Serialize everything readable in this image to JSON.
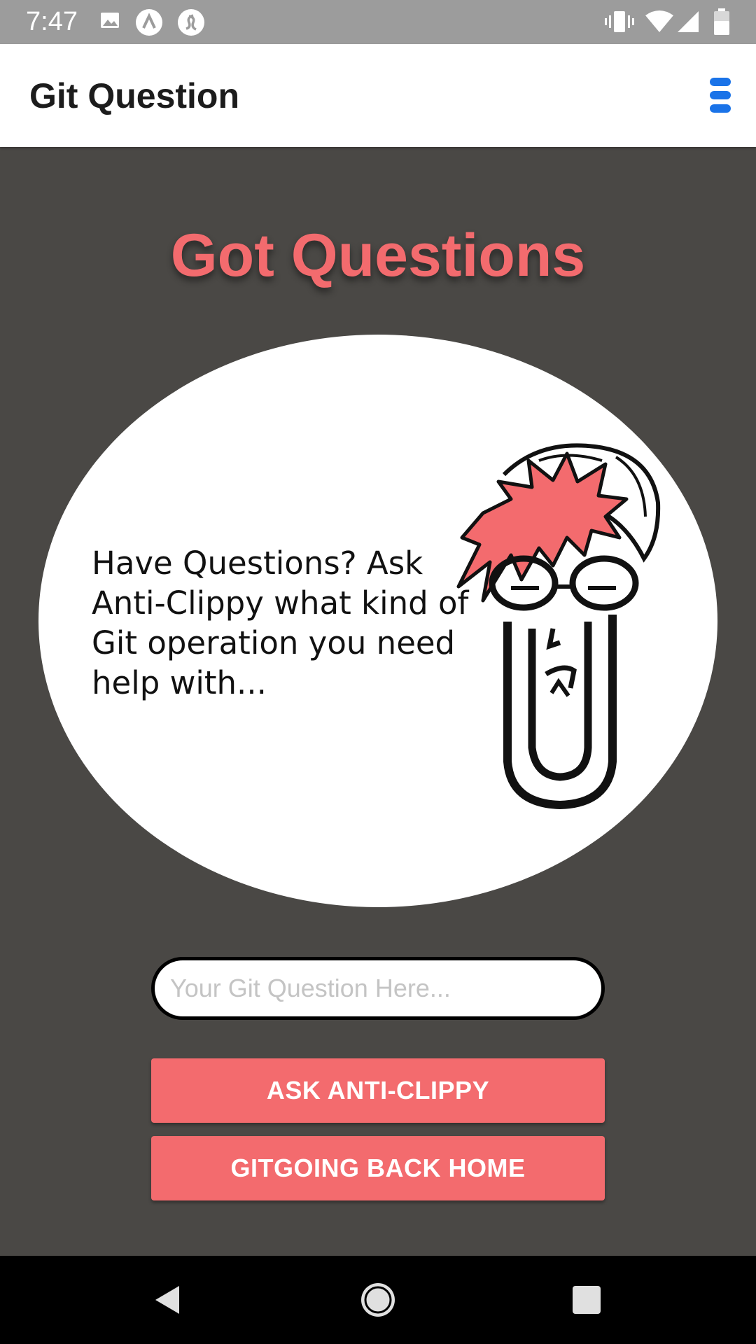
{
  "status_bar": {
    "time": "7:47",
    "left_icons": [
      "image-icon",
      "app-a-icon",
      "shazam-icon"
    ],
    "right_icons": [
      "vibrate-icon",
      "wifi-icon",
      "cell-signal-icon",
      "battery-icon"
    ]
  },
  "app_bar": {
    "title": "Git Question",
    "menu_icon": "menu-icon"
  },
  "main": {
    "heading": "Got Questions",
    "bubble_text": "Have Questions?  Ask Anti-Clippy what kind of Git operation you need help with...",
    "mascot_icon": "anti-clippy-illustration",
    "input": {
      "value": "",
      "placeholder": "Your Git Question Here..."
    },
    "ask_button": "ASK ANTI-CLIPPY",
    "home_button": "GITGOING BACK HOME"
  },
  "nav_bar": {
    "icons": [
      "back-icon",
      "home-icon",
      "recents-icon"
    ]
  },
  "colors": {
    "accent": "#f36b6e",
    "background": "#4a4845",
    "menu_icon": "#1a73e8"
  }
}
